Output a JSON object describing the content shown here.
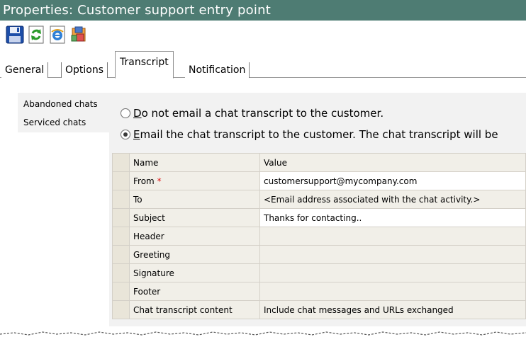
{
  "window": {
    "title": "Properties: Customer support entry point"
  },
  "toolbar": {
    "buttons": [
      {
        "icon": "save-icon"
      },
      {
        "icon": "refresh-icon"
      },
      {
        "icon": "browser-icon"
      },
      {
        "icon": "tools-icon"
      }
    ]
  },
  "tabs": {
    "general": "General",
    "options": "Options",
    "transcript": "Transcript",
    "notification": "Notification",
    "active": "Transcript"
  },
  "left_list": {
    "items": [
      "Abandoned chats",
      "Serviced chats"
    ],
    "selected": "Abandoned chats"
  },
  "options": {
    "no_email": {
      "underline": "D",
      "rest": "o not email a chat transcript to the customer.",
      "checked": false
    },
    "email": {
      "underline": "E",
      "rest": "mail the chat transcript to the customer. The chat transcript will be",
      "checked": true
    }
  },
  "grid": {
    "columns": [
      "Name",
      "Value"
    ],
    "rows": [
      {
        "name": "From",
        "required_mark": "*",
        "value": "customersupport@mycompany.com"
      },
      {
        "name": "To",
        "value": "<Email address associated with the chat activity.>"
      },
      {
        "name": "Subject",
        "value": "Thanks for contacting.."
      },
      {
        "name": "Header",
        "value": ""
      },
      {
        "name": "Greeting",
        "value": ""
      },
      {
        "name": "Signature",
        "value": ""
      },
      {
        "name": "Footer",
        "value": ""
      },
      {
        "name": "Chat transcript content",
        "value": "Include chat messages and URLs exchanged"
      }
    ]
  },
  "colors": {
    "titlebar": "#4e7c73",
    "panel": "#f2f2f2",
    "required": "#e01010"
  }
}
